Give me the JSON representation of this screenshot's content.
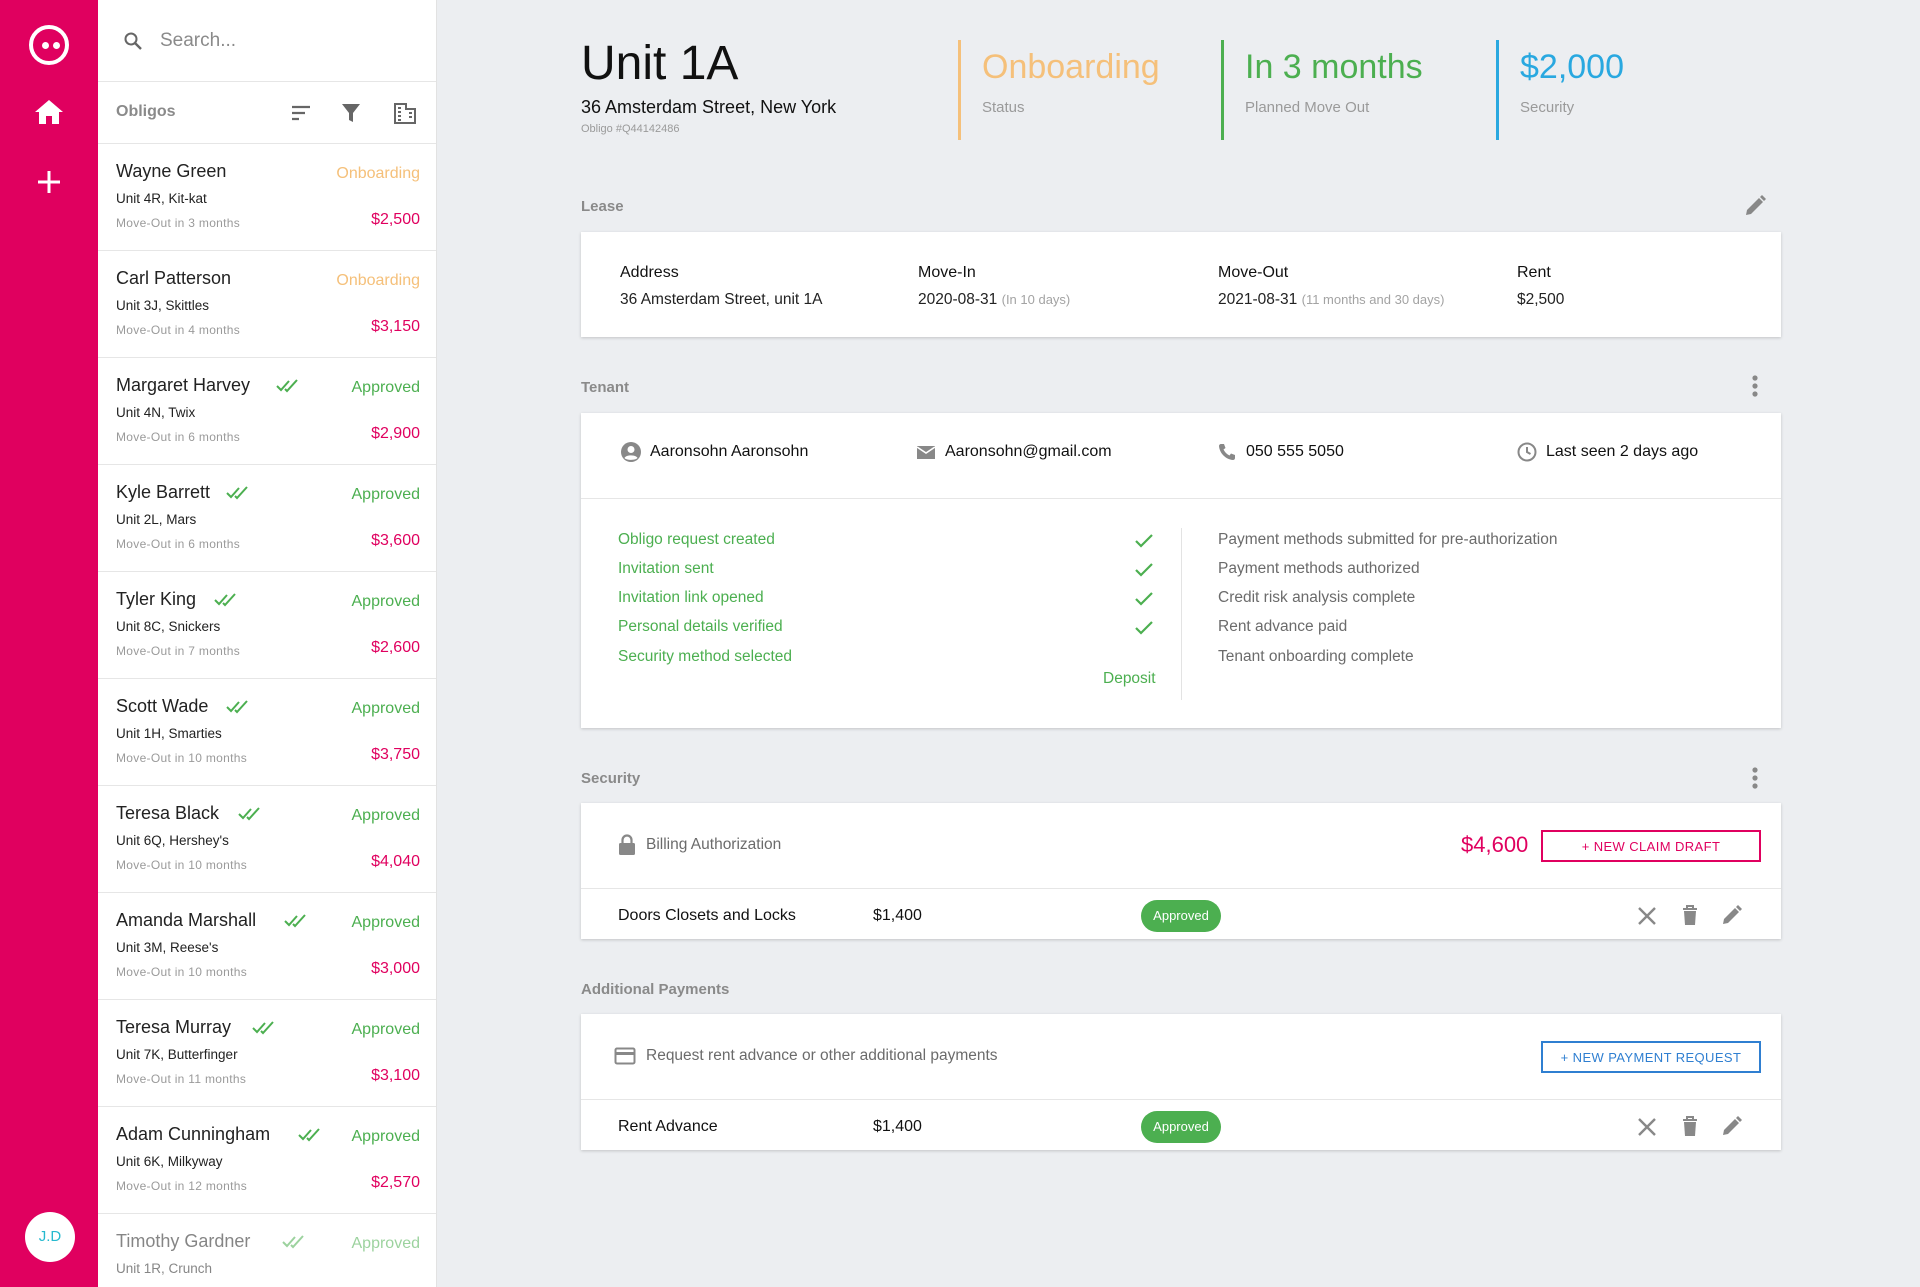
{
  "app": {
    "avatar_initials": "J.D"
  },
  "search": {
    "placeholder": "Search..."
  },
  "list": {
    "title": "Obligos",
    "items": [
      {
        "name": "Wayne Green",
        "unit": "Unit 4R, Kit-kat",
        "move": "Move-Out in 3 months",
        "status": "Onboarding",
        "amount": "$2,500"
      },
      {
        "name": "Carl Patterson",
        "unit": "Unit 3J, Skittles",
        "move": "Move-Out in 4 months",
        "status": "Onboarding",
        "amount": "$3,150"
      },
      {
        "name": "Margaret Harvey",
        "unit": "Unit 4N, Twix",
        "move": "Move-Out in 6 months",
        "status": "Approved",
        "amount": "$2,900"
      },
      {
        "name": "Kyle Barrett",
        "unit": "Unit 2L, Mars",
        "move": "Move-Out in 6 months",
        "status": "Approved",
        "amount": "$3,600"
      },
      {
        "name": "Tyler King",
        "unit": "Unit 8C, Snickers",
        "move": "Move-Out in 7 months",
        "status": "Approved",
        "amount": "$2,600"
      },
      {
        "name": "Scott Wade",
        "unit": "Unit 1H, Smarties",
        "move": "Move-Out in 10 months",
        "status": "Approved",
        "amount": "$3,750"
      },
      {
        "name": "Teresa Black",
        "unit": "Unit 6Q, Hershey's",
        "move": "Move-Out in 10 months",
        "status": "Approved",
        "amount": "$4,040"
      },
      {
        "name": "Amanda Marshall",
        "unit": "Unit 3M, Reese's",
        "move": "Move-Out in 10 months",
        "status": "Approved",
        "amount": "$3,000"
      },
      {
        "name": "Teresa Murray",
        "unit": "Unit 7K, Butterfinger",
        "move": "Move-Out in 11 months",
        "status": "Approved",
        "amount": "$3,100"
      },
      {
        "name": "Adam Cunningham",
        "unit": "Unit 6K, Milkyway",
        "move": "Move-Out in 12 months",
        "status": "Approved",
        "amount": "$2,570"
      },
      {
        "name": "Timothy Gardner",
        "unit": "Unit 1R, Crunch",
        "move": "",
        "status": "Approved",
        "amount": ""
      }
    ]
  },
  "header": {
    "title": "Unit 1A",
    "address": "36 Amsterdam Street, New York",
    "obligo_id": "Obligo #Q44142486",
    "stats": [
      {
        "value": "Onboarding",
        "label": "Status",
        "color": "#f5c07a"
      },
      {
        "value": "In 3 months",
        "label": "Planned Move Out",
        "color": "#4caf50"
      },
      {
        "value": "$2,000",
        "label": "Security",
        "color": "#29a8e0"
      }
    ]
  },
  "lease": {
    "title": "Lease",
    "address_label": "Address",
    "address_value": "36 Amsterdam Street, unit 1A",
    "movein_label": "Move-In",
    "movein_value": "2020-08-31",
    "movein_note": "(In 10 days)",
    "moveout_label": "Move-Out",
    "moveout_value": "2021-08-31",
    "moveout_note": "(11 months and 30 days)",
    "rent_label": "Rent",
    "rent_value": "$2,500"
  },
  "tenant": {
    "title": "Tenant",
    "name": "Aaronsohn Aaronsohn",
    "email": "Aaronsohn@gmail.com",
    "phone": "050 555 5050",
    "last_seen": "Last seen 2 days ago",
    "done_steps": [
      "Obligo request created",
      "Invitation sent",
      "Invitation link opened",
      "Personal details verified",
      "Security method selected"
    ],
    "deposit_label": "Deposit",
    "pending_steps": [
      "Payment methods submitted for pre-authorization",
      "Payment methods authorized",
      "Credit risk analysis complete",
      "Rent advance paid",
      "Tenant onboarding complete"
    ]
  },
  "security": {
    "title": "Security",
    "billing_label": "Billing Authorization",
    "billing_amount": "$4,600",
    "new_claim": "+ NEW CLAIM DRAFT",
    "row": {
      "name": "Doors Closets and Locks",
      "amount": "$1,400",
      "status": "Approved"
    }
  },
  "payments": {
    "title": "Additional Payments",
    "prompt": "Request rent advance or other additional payments",
    "new_request": "+ NEW PAYMENT REQUEST",
    "row": {
      "name": "Rent Advance",
      "amount": "$1,400",
      "status": "Approved"
    }
  }
}
